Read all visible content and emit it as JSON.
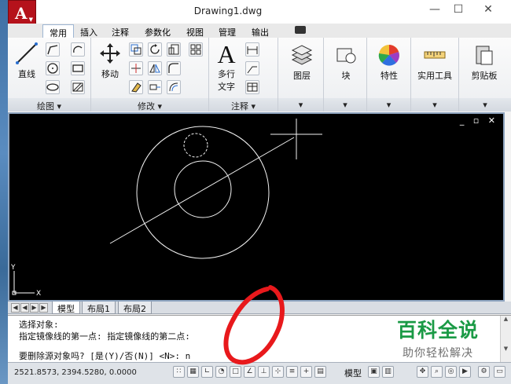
{
  "window": {
    "title": "Drawing1.dwg",
    "app_logo": "A",
    "controls": {
      "minimize": "—",
      "maximize": "☐",
      "close": "✕"
    }
  },
  "ribbon_tabs": [
    "常用",
    "插入",
    "注释",
    "参数化",
    "视图",
    "管理",
    "输出"
  ],
  "active_tab": "常用",
  "panels": {
    "draw": {
      "footer": "绘图 ▾",
      "line_label": "直线"
    },
    "modify": {
      "footer": "修改 ▾",
      "move_label": "移动"
    },
    "annotation": {
      "footer": "注释 ▾",
      "mtext_label_1": "多行",
      "mtext_label_2": "文字"
    },
    "layers": {
      "label": "图层",
      "footer": "▾"
    },
    "block": {
      "label": "块",
      "footer": "▾"
    },
    "properties": {
      "label": "特性",
      "footer": "▾"
    },
    "utilities": {
      "label": "实用工具",
      "footer": "▾"
    },
    "clipboard": {
      "label": "剪贴板",
      "footer": "▾"
    }
  },
  "canvas": {
    "controls": [
      "_",
      "▫",
      "✕"
    ],
    "ucs_y": "Y",
    "ucs_x": "X"
  },
  "layout_tabs": [
    "模型",
    "布局1",
    "布局2"
  ],
  "active_layout": "模型",
  "command_lines": [
    "选择对象:",
    "指定镜像线的第一点: 指定镜像线的第二点:",
    "要删除源对象吗? [是(Y)/否(N)] <N>: n"
  ],
  "status": {
    "coordinates": "2521.8573,  2394.5280, 0.0000",
    "model_label": "模型"
  },
  "watermark": {
    "main": "百科全说",
    "sub": "助你轻松解决"
  },
  "colors": {
    "accent_red": "#b5121b",
    "canvas_bg": "#000000",
    "watermark_green": "#1a9a45",
    "annotation_red": "#e8191c"
  }
}
